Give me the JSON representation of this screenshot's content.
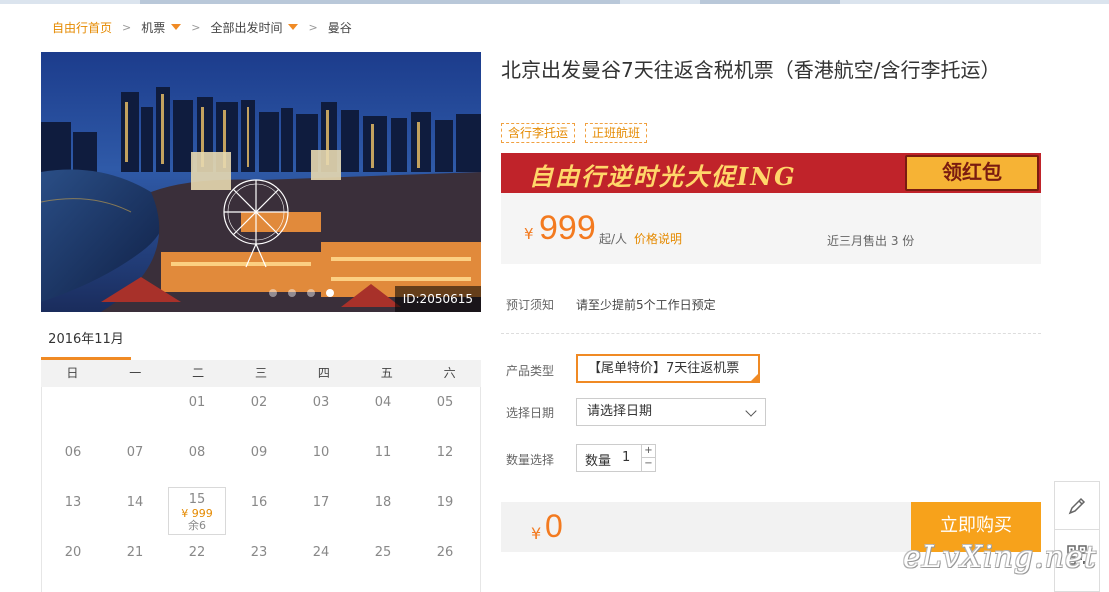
{
  "breadcrumb": {
    "home": "自由行首页",
    "category": "机票",
    "departure_time": "全部出发时间",
    "current": "曼谷"
  },
  "hero": {
    "image_id": "ID:2050615",
    "slide_count": 4,
    "active_slide": 4
  },
  "calendar": {
    "month": "2016年11月",
    "weekdays": [
      "日",
      "一",
      "二",
      "三",
      "四",
      "五",
      "六"
    ],
    "rows": [
      [
        {
          "day": ""
        },
        {
          "day": ""
        },
        {
          "day": "01"
        },
        {
          "day": "02"
        },
        {
          "day": "03"
        },
        {
          "day": "04"
        },
        {
          "day": "05"
        }
      ],
      [
        {
          "day": "06"
        },
        {
          "day": "07"
        },
        {
          "day": "08"
        },
        {
          "day": "09"
        },
        {
          "day": "10"
        },
        {
          "day": "11"
        },
        {
          "day": "12"
        }
      ],
      [
        {
          "day": "13"
        },
        {
          "day": "14"
        },
        {
          "day": "15",
          "price": "¥ 999",
          "remain": "余6"
        },
        {
          "day": "16"
        },
        {
          "day": "17"
        },
        {
          "day": "18"
        },
        {
          "day": "19"
        }
      ],
      [
        {
          "day": "20"
        },
        {
          "day": "21"
        },
        {
          "day": "22"
        },
        {
          "day": "23"
        },
        {
          "day": "24"
        },
        {
          "day": "25"
        },
        {
          "day": "26"
        }
      ]
    ]
  },
  "product": {
    "title": "北京出发曼谷7天往返含税机票（香港航空/含行李托运）",
    "tags": [
      "含行李托运",
      "正班航班"
    ],
    "banner_text": "自由行逆时光大促ING",
    "banner_button": "领红包",
    "price_currency": "¥",
    "price": "999",
    "price_unit": "起/人",
    "price_explain": "价格说明",
    "sold": "近三月售出 3 份"
  },
  "booking": {
    "notice_label": "预订须知",
    "notice_text": "请至少提前5个工作日预定",
    "type_label": "产品类型",
    "type_value": "【尾单特价】7天往返机票",
    "date_label": "选择日期",
    "date_placeholder": "请选择日期",
    "qty_label": "数量选择",
    "qty_inner_label": "数量",
    "qty_value": "1",
    "total_currency": "¥",
    "total": "0",
    "buy_button": "立即购买"
  },
  "watermark": "eLvXing.net",
  "colors": {
    "accent": "#f37a1f",
    "buy": "#f7a21b",
    "banner": "#c0232a"
  }
}
